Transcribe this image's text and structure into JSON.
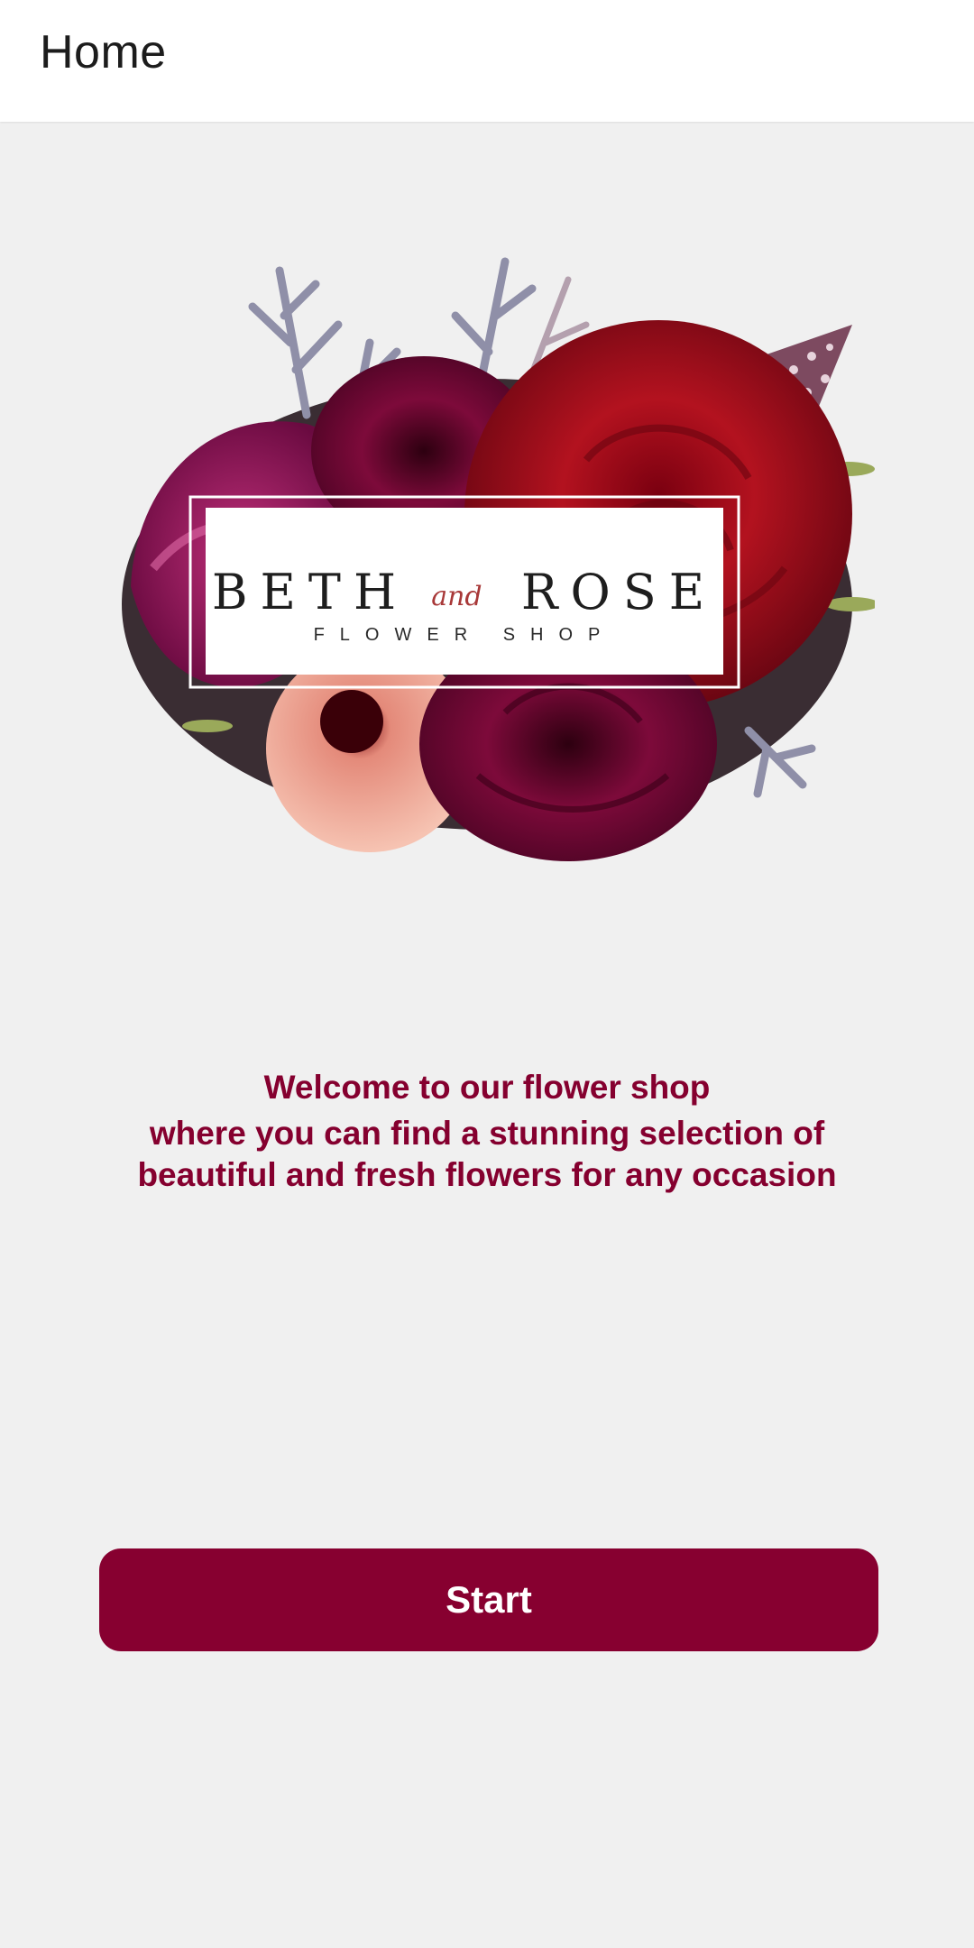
{
  "app_bar": {
    "title": "Home"
  },
  "logo": {
    "brand_left": "BETH",
    "brand_joiner": "and",
    "brand_right": "ROSE",
    "tagline": "FLOWER SHOP",
    "image": "flower-bouquet-logo"
  },
  "welcome": {
    "heading": "Welcome to our flower shop",
    "body": "where you can find a stunning selection of beautiful and fresh flowers for any occasion"
  },
  "actions": {
    "start_label": "Start"
  },
  "colors": {
    "accent": "#870030",
    "text_accent": "#85002f",
    "background": "#f0f0f0",
    "app_bar": "#ffffff"
  }
}
